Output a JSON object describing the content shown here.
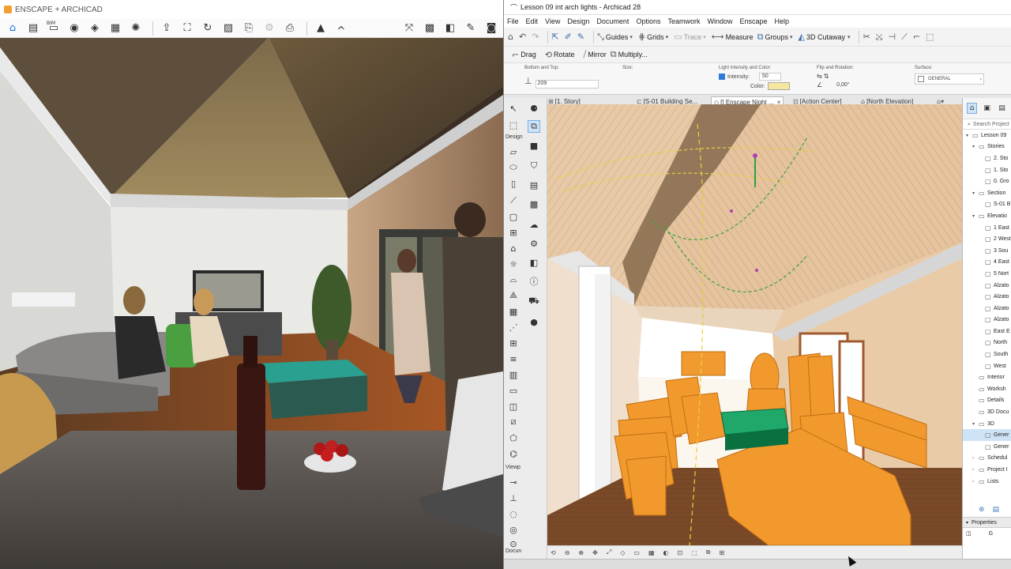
{
  "enscape": {
    "title": "ENSCAPE + ARCHICAD",
    "toolbar": {
      "bim_label": "BIM",
      "icons": [
        "home-icon",
        "document-icon",
        "bim-icon",
        "view-icon",
        "capture-icon",
        "panel-icon",
        "lens-icon",
        "upload-icon",
        "screenshot-icon",
        "panorama-icon",
        "image-icon",
        "export-icon",
        "settings-icon",
        "batch-icon",
        "asset-icon",
        "collapse-icon",
        "sync-icon",
        "material-icon",
        "cube-icon",
        "feedback-icon",
        "vr-icon"
      ]
    }
  },
  "archicad": {
    "title": "Lesson 09 int arch lights - Archicad 28",
    "menu": [
      "File",
      "Edit",
      "View",
      "Design",
      "Document",
      "Options",
      "Teamwork",
      "Window",
      "Enscape",
      "Help"
    ],
    "toolbar1": {
      "guides": "Guides",
      "grids": "Grids",
      "trace": "Trace",
      "measure": "Measure",
      "groups": "Groups",
      "cutaway": "3D Cutaway"
    },
    "toolbar2": {
      "drag": "Drag",
      "rotate": "Rotate",
      "mirror": "Mirror",
      "multiply": "Multiply..."
    },
    "info_box": {
      "bottom_top_label": "Bottom and Top:",
      "bottom_top_value": "209",
      "size_label": "Size:",
      "light_label": "Light Intensity and Color:",
      "intensity_label": "Intensity:",
      "intensity_value": "50",
      "color_label": "Color:",
      "light_color": "#f6e7a0",
      "flip_label": "Flip and Rotation:",
      "rotation_value": "0,00°",
      "surface_label": "Surface:",
      "surface_value": "GENERAL"
    },
    "tabs": [
      {
        "label": "[1. Story]",
        "icon": "floorplan-icon"
      },
      {
        "label": "[S-01 Building Se...",
        "icon": "section-icon"
      },
      {
        "label": "[] Enscape Night ...",
        "icon": "3d-window-icon",
        "active": true,
        "close": "×"
      },
      {
        "label": "[Action Center]",
        "icon": "action-center-icon"
      },
      {
        "label": "[North Elevation]",
        "icon": "elevation-icon"
      }
    ],
    "toolbox": {
      "design_label": "Design",
      "viewpoint_label": "Viewp",
      "document_label": "Docun"
    },
    "navigator": {
      "search_placeholder": "Search Project",
      "items": [
        {
          "label": "Lesson 09",
          "indent": 0,
          "caret": "▾"
        },
        {
          "label": "Stories",
          "indent": 1,
          "caret": "▾"
        },
        {
          "label": "2. Sto",
          "indent": 2,
          "caret": ""
        },
        {
          "label": "1. Sto",
          "indent": 2,
          "caret": ""
        },
        {
          "label": "0. Gro",
          "indent": 2,
          "caret": ""
        },
        {
          "label": "Section",
          "indent": 1,
          "caret": "▾"
        },
        {
          "label": "S-01 B",
          "indent": 2,
          "caret": ""
        },
        {
          "label": "Elevatio",
          "indent": 1,
          "caret": "▾"
        },
        {
          "label": "1 East",
          "indent": 2,
          "caret": ""
        },
        {
          "label": "2 West",
          "indent": 2,
          "caret": ""
        },
        {
          "label": "3 Sou",
          "indent": 2,
          "caret": ""
        },
        {
          "label": "4 East",
          "indent": 2,
          "caret": ""
        },
        {
          "label": "5 Nort",
          "indent": 2,
          "caret": ""
        },
        {
          "label": "Alzato",
          "indent": 2,
          "caret": ""
        },
        {
          "label": "Alzato",
          "indent": 2,
          "caret": ""
        },
        {
          "label": "Alzato",
          "indent": 2,
          "caret": ""
        },
        {
          "label": "Alzato",
          "indent": 2,
          "caret": ""
        },
        {
          "label": "East E",
          "indent": 2,
          "caret": ""
        },
        {
          "label": "North",
          "indent": 2,
          "caret": ""
        },
        {
          "label": "South",
          "indent": 2,
          "caret": ""
        },
        {
          "label": "West",
          "indent": 2,
          "caret": ""
        },
        {
          "label": "Interior",
          "indent": 1,
          "caret": ""
        },
        {
          "label": "Worksh",
          "indent": 1,
          "caret": ""
        },
        {
          "label": "Details",
          "indent": 1,
          "caret": ""
        },
        {
          "label": "3D Docu",
          "indent": 1,
          "caret": ""
        },
        {
          "label": "3D",
          "indent": 1,
          "caret": "▾"
        },
        {
          "label": "Gener",
          "indent": 2,
          "caret": "",
          "selected": true
        },
        {
          "label": "Gener",
          "indent": 2,
          "caret": ""
        },
        {
          "label": "Schedul",
          "indent": 1,
          "caret": "›"
        },
        {
          "label": "Project I",
          "indent": 1,
          "caret": "›"
        },
        {
          "label": "Lists",
          "indent": 1,
          "caret": "›"
        }
      ],
      "properties_label": "Properties",
      "properties_value": "G"
    }
  }
}
